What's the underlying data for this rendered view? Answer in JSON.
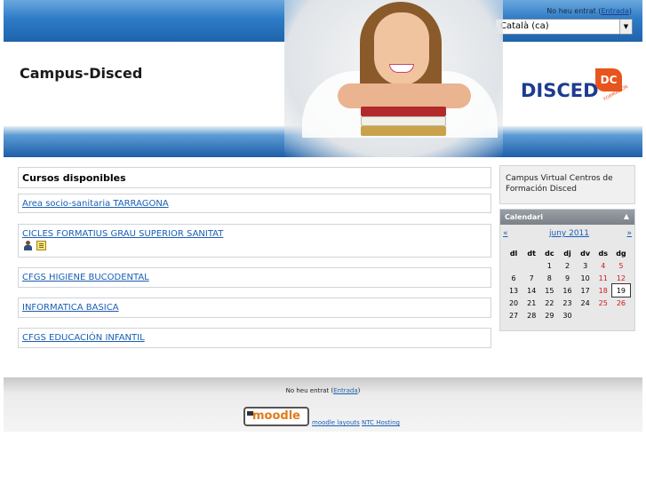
{
  "header": {
    "login_prefix": "No heu entrat (",
    "login_link": "Entrada",
    "login_suffix": ")",
    "language_selected": "Català (ca)",
    "site_title": "Campus-Disced",
    "logo_text": "DISCED",
    "logo_mark": "DC",
    "logo_sub": "FORMACIÓN"
  },
  "courses": {
    "heading": "Cursos disponibles",
    "items": [
      {
        "name": "Area socio-sanitaria TARRAGONA"
      },
      {
        "name": "CICLES FORMATIUS GRAU SUPERIOR SANITAT"
      },
      {
        "name": "CFGS HIGIENE BUCODENTAL"
      },
      {
        "name": "INFORMATICA BASICA"
      },
      {
        "name": "CFGS EDUCACIÓN INFANTIL"
      }
    ]
  },
  "sidebar": {
    "campus_text": "Campus Virtual Centros de Formación Disced",
    "calendar": {
      "title": "Calendari",
      "toggle": "−",
      "prev": "«",
      "month": "juny 2011",
      "next": "»",
      "weekdays": [
        "dl",
        "dt",
        "dc",
        "dj",
        "dv",
        "ds",
        "dg"
      ],
      "weeks": [
        [
          "",
          "",
          "1",
          "2",
          "3",
          "4",
          "5"
        ],
        [
          "6",
          "7",
          "8",
          "9",
          "10",
          "11",
          "12"
        ],
        [
          "13",
          "14",
          "15",
          "16",
          "17",
          "18",
          "19"
        ],
        [
          "20",
          "21",
          "22",
          "23",
          "24",
          "25",
          "26"
        ],
        [
          "27",
          "28",
          "29",
          "30",
          "",
          "",
          ""
        ]
      ],
      "today": "19"
    }
  },
  "footer": {
    "login_prefix": "No heu entrat (",
    "login_link": "Entrada",
    "login_suffix": ")",
    "moodle_logo": "moodle",
    "moodle_layouts": "moodle layouts",
    "ntc_hosting": "NTC Hosting"
  },
  "colors": {
    "header_blue": "#2e7bc7",
    "link_blue": "#1a5fb4",
    "weekend_red": "#d01818",
    "logo_orange": "#e8541e"
  }
}
